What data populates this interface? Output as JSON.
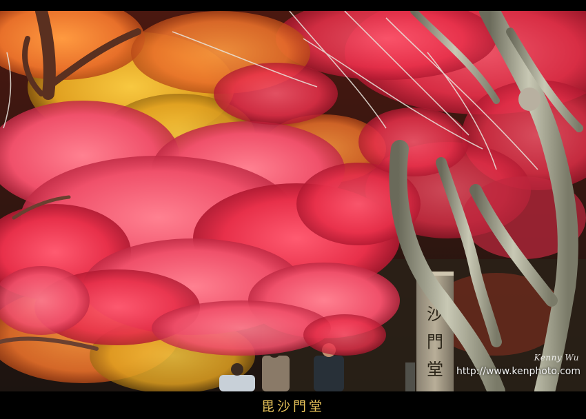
{
  "caption": "毘沙門堂",
  "signature": "Kenny Wu",
  "url": "http://www.kenphoto.com",
  "pillar_text": "沙門堂",
  "colors": {
    "frame": "#000000",
    "caption": "#e8c35a",
    "foliage_red": "#e8304a",
    "foliage_pink": "#f0506a",
    "foliage_orange": "#e8702a",
    "foliage_yellow": "#e0a020",
    "bark": "#9a9a86"
  }
}
